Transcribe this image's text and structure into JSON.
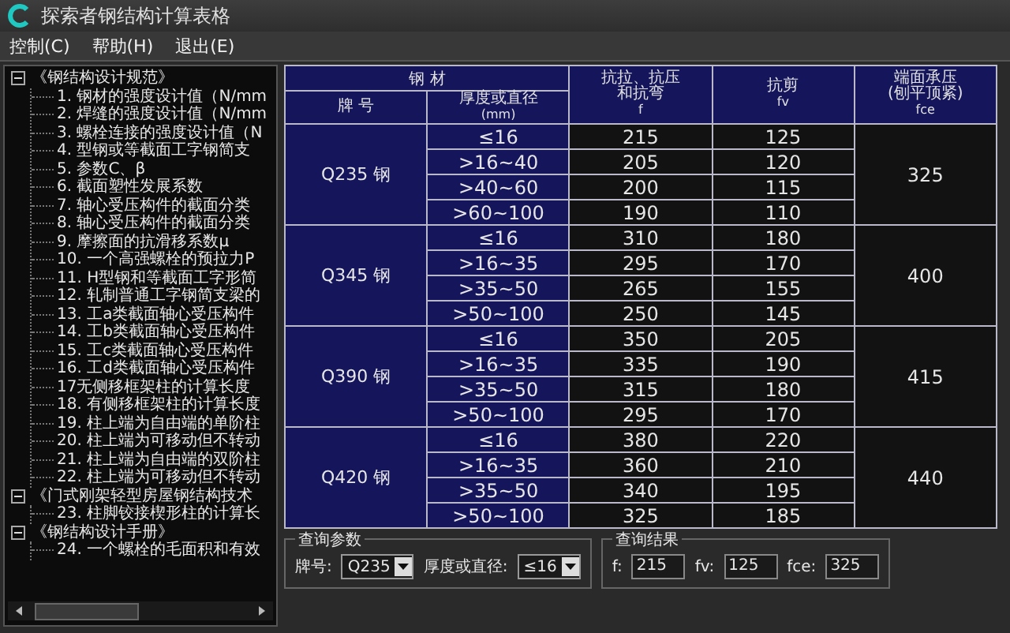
{
  "window": {
    "title": "探索者钢结构计算表格"
  },
  "menu": [
    "控制(C)",
    "帮助(H)",
    "退出(E)"
  ],
  "tree": [
    {
      "label": "《钢结构设计规范》",
      "expanded": true,
      "children": [
        {
          "label": "1. 钢材的强度设计值（N/mm"
        },
        {
          "label": "2. 焊缝的强度设计值（N/mm"
        },
        {
          "label": "3. 螺栓连接的强度设计值（N"
        },
        {
          "label": "4. 型钢或等截面工字钢简支"
        },
        {
          "label": "5. 参数C、β"
        },
        {
          "label": "6. 截面塑性发展系数"
        },
        {
          "label": "7. 轴心受压构件的截面分类"
        },
        {
          "label": "8. 轴心受压构件的截面分类"
        },
        {
          "label": "9. 摩擦面的抗滑移系数μ"
        },
        {
          "label": "10. 一个高强螺栓的预拉力P"
        },
        {
          "label": "11. H型钢和等截面工字形简"
        },
        {
          "label": "12. 轧制普通工字钢简支梁的"
        },
        {
          "label": "13. 工a类截面轴心受压构件"
        },
        {
          "label": "14. 工b类截面轴心受压构件"
        },
        {
          "label": "15. 工c类截面轴心受压构件"
        },
        {
          "label": "16. 工d类截面轴心受压构件"
        },
        {
          "label": "17无侧移框架柱的计算长度"
        },
        {
          "label": "18. 有侧移框架柱的计算长度"
        },
        {
          "label": "19. 柱上端为自由端的单阶柱"
        },
        {
          "label": "20. 柱上端为可移动但不转动"
        },
        {
          "label": "21. 柱上端为自由端的双阶柱"
        },
        {
          "label": "22. 柱上端为可移动但不转动"
        }
      ]
    },
    {
      "label": "《门式刚架轻型房屋钢结构技术",
      "expanded": true,
      "children": [
        {
          "label": "23. 柱脚铰接楔形柱的计算长"
        }
      ]
    },
    {
      "label": "《钢结构设计手册》",
      "expanded": true,
      "children": [
        {
          "label": "24. 一个螺栓的毛面积和有效"
        }
      ]
    }
  ],
  "table": {
    "group": "钢 材",
    "columns": [
      {
        "lines": [
          "牌 号"
        ]
      },
      {
        "lines": [
          "厚度或直径"
        ],
        "unit": "(mm)"
      },
      {
        "lines": [
          "抗拉、抗压",
          "和抗弯"
        ],
        "unit": "f"
      },
      {
        "lines": [
          "抗剪"
        ],
        "unit": "fv"
      },
      {
        "lines": [
          "端面承压",
          "(刨平顶紧)"
        ],
        "unit": "fce"
      }
    ],
    "grades": [
      {
        "grade": "Q235 钢",
        "fce": "325",
        "rows": [
          {
            "thickness": "≤16",
            "f": "215",
            "fv": "125"
          },
          {
            "thickness": ">16~40",
            "f": "205",
            "fv": "120"
          },
          {
            "thickness": ">40~60",
            "f": "200",
            "fv": "115"
          },
          {
            "thickness": ">60~100",
            "f": "190",
            "fv": "110"
          }
        ]
      },
      {
        "grade": "Q345 钢",
        "fce": "400",
        "rows": [
          {
            "thickness": "≤16",
            "f": "310",
            "fv": "180"
          },
          {
            "thickness": ">16~35",
            "f": "295",
            "fv": "170"
          },
          {
            "thickness": ">35~50",
            "f": "265",
            "fv": "155"
          },
          {
            "thickness": ">50~100",
            "f": "250",
            "fv": "145"
          }
        ]
      },
      {
        "grade": "Q390 钢",
        "fce": "415",
        "rows": [
          {
            "thickness": "≤16",
            "f": "350",
            "fv": "205"
          },
          {
            "thickness": ">16~35",
            "f": "335",
            "fv": "190"
          },
          {
            "thickness": ">35~50",
            "f": "315",
            "fv": "180"
          },
          {
            "thickness": ">50~100",
            "f": "295",
            "fv": "170"
          }
        ]
      },
      {
        "grade": "Q420 钢",
        "fce": "440",
        "rows": [
          {
            "thickness": "≤16",
            "f": "380",
            "fv": "220"
          },
          {
            "thickness": ">16~35",
            "f": "360",
            "fv": "210"
          },
          {
            "thickness": ">35~50",
            "f": "340",
            "fv": "195"
          },
          {
            "thickness": ">50~100",
            "f": "325",
            "fv": "185"
          }
        ]
      }
    ]
  },
  "query_params": {
    "title": "查询参数",
    "fields": [
      {
        "label": "牌号:",
        "value": "Q235"
      },
      {
        "label": "厚度或直径:",
        "value": "≤16"
      }
    ]
  },
  "query_results": {
    "title": "查询结果",
    "fields": [
      {
        "label": "f:",
        "value": "215"
      },
      {
        "label": "fv:",
        "value": "125"
      },
      {
        "label": "fce:",
        "value": "325"
      }
    ]
  }
}
